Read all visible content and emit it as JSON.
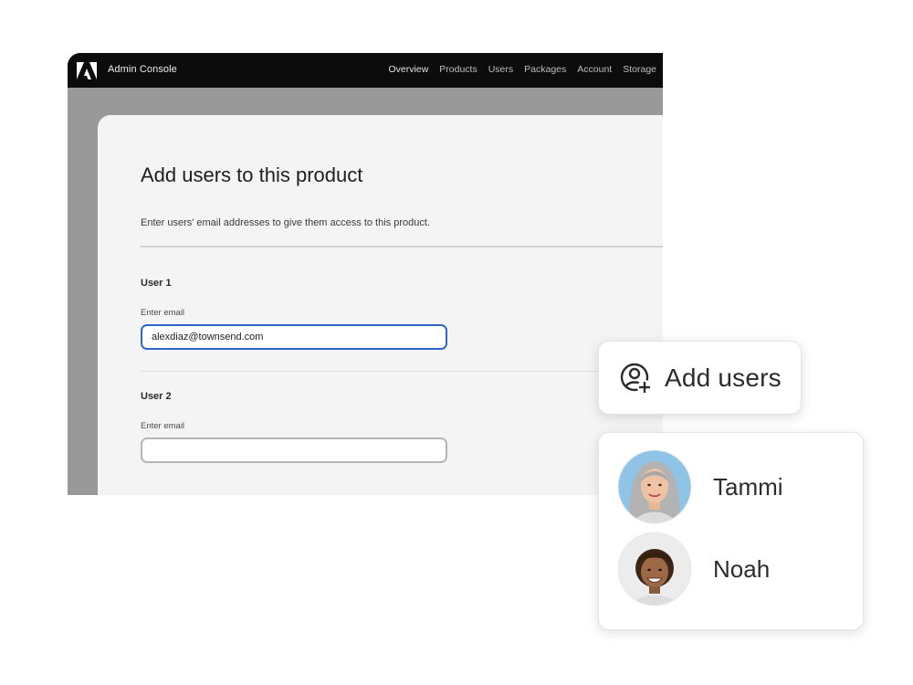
{
  "app": {
    "title": "Admin Console",
    "logo_icon": "adobe-logo-icon",
    "nav": [
      "Overview",
      "Products",
      "Users",
      "Packages",
      "Account",
      "Storage"
    ]
  },
  "dialog": {
    "title": "Add users to this product",
    "description": "Enter users' email addresses to give them access to this product.",
    "users": [
      {
        "heading": "User 1",
        "field_label": "Enter email",
        "value": "alexdiaz@townsend.com",
        "placeholder": ""
      },
      {
        "heading": "User 2",
        "field_label": "Enter email",
        "value": "",
        "placeholder": ""
      }
    ]
  },
  "add_users_card": {
    "label": "Add users",
    "icon": "add-user-icon"
  },
  "people": [
    {
      "name": "Tammi",
      "avatar": "avatar-photo"
    },
    {
      "name": "Noah",
      "avatar": "avatar-photo"
    }
  ],
  "colors": {
    "focus_border": "#2f66c9",
    "topbar": "#0c0c0c"
  }
}
